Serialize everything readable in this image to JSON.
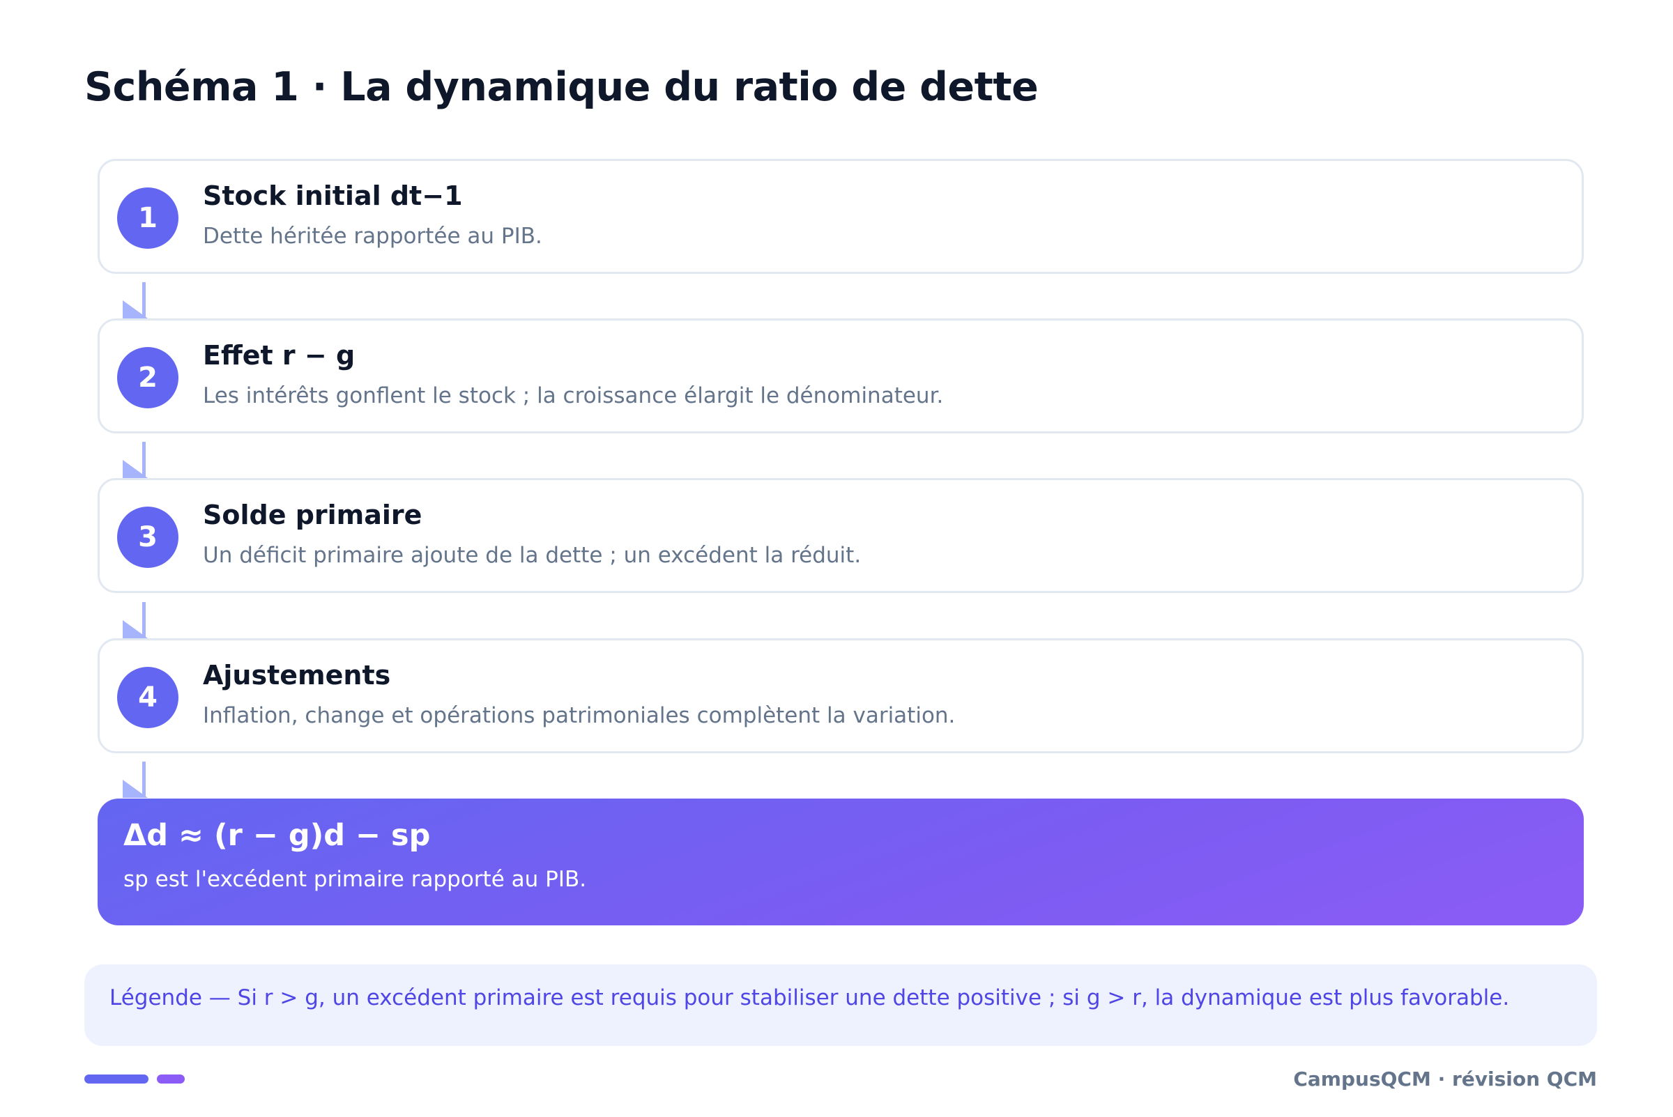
{
  "title": "Schéma 1 · La dynamique du ratio de dette",
  "steps": [
    {
      "number": "1",
      "title": "Stock initial dt−1",
      "description": "Dette héritée rapportée au PIB."
    },
    {
      "number": "2",
      "title": "Effet r − g",
      "description": "Les intérêts gonflent le stock ; la croissance élargit le dénominateur."
    },
    {
      "number": "3",
      "title": "Solde primaire",
      "description": "Un déficit primaire ajoute de la dette ; un excédent la réduit."
    },
    {
      "number": "4",
      "title": "Ajustements",
      "description": "Inflation, change et opérations patrimoniales complètent la variation."
    }
  ],
  "formula": {
    "title": "Δd ≈ (r − g)d − sp",
    "description": "sp est l'excédent primaire rapporté au PIB."
  },
  "legend": {
    "text": "Légende — Si r > g, un excédent primaire est requis pour stabiliser une dette positive ; si g > r, la dynamique est plus favorable."
  },
  "footer": "CampusQCM · révision QCM",
  "colors": {
    "accent": "#6366f1",
    "accent_secondary": "#8b5cf6",
    "connector": "#a5b4fc",
    "legend_bg": "#eef2ff",
    "legend_text": "#4f46e5"
  }
}
